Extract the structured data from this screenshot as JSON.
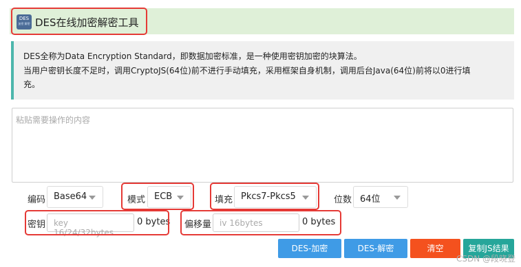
{
  "header": {
    "logo_text": "DES",
    "logo_subtext": "加密 解密",
    "title": "DES在线加密解密工具"
  },
  "info": {
    "line1": "DES全称为Data Encryption Standard，即数据加密标准，是一种使用密钥加密的块算法。",
    "line2": "当用户密钥长度不足时，调用CryptoJS(64位)前不进行手动填充，采用框架自身机制，调用后台Java(64位)前将以0进行填",
    "line3": "充。"
  },
  "input_area": {
    "placeholder": "粘贴需要操作的内容"
  },
  "options": {
    "encoding_label": "编码",
    "encoding_value": "Base64",
    "mode_label": "模式",
    "mode_value": "ECB",
    "padding_label": "填充",
    "padding_value": "Pkcs7-Pkcs5",
    "bits_label": "位数",
    "bits_value": "64位"
  },
  "key": {
    "label": "密钥",
    "placeholder": "key 16/24/32bytes",
    "bytes": "0 bytes"
  },
  "iv": {
    "label": "偏移量",
    "placeholder": "iv 16bytes",
    "bytes": "0 bytes"
  },
  "buttons": {
    "encrypt": "DES-加密",
    "decrypt": "DES-解密",
    "clear": "清空",
    "copy_js": "复制JS结果"
  },
  "colors": {
    "encrypt": "#3f9be6",
    "decrypt": "#3f9be6",
    "clear": "#f4511e",
    "copy_js": "#26a69a",
    "highlight": "#e53935"
  },
  "watermark": "CSDN @段晓登"
}
